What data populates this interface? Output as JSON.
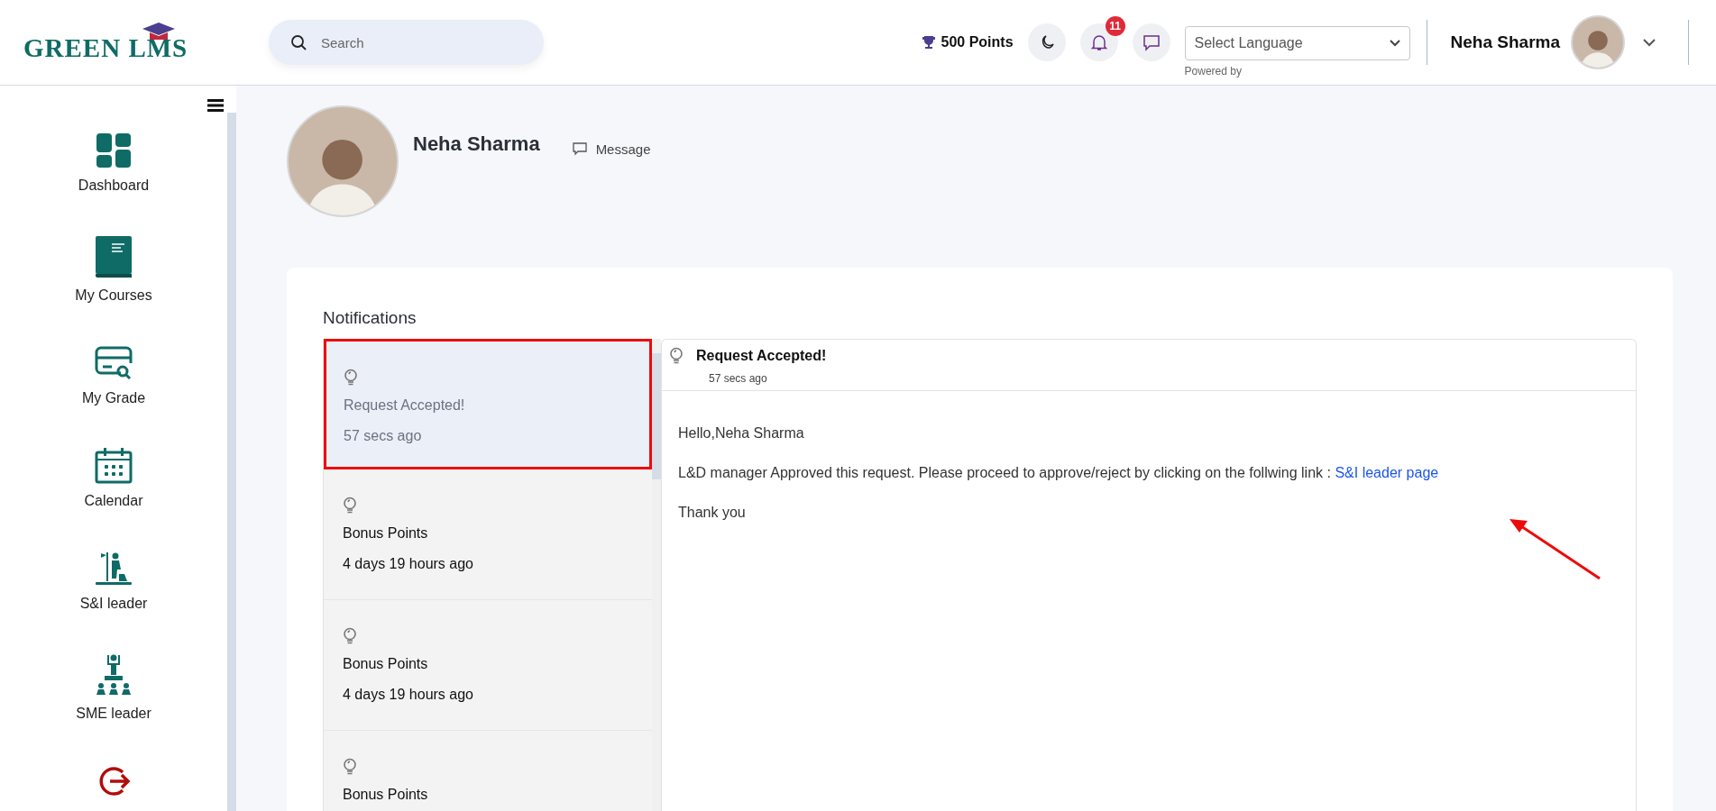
{
  "header": {
    "logo": "GREEN LMS",
    "search": {
      "placeholder": "Search"
    },
    "points": "500 Points",
    "notification_count": "11",
    "language_select": {
      "value": "Select Language",
      "note": "Powered by"
    },
    "user_name": "Neha Sharma"
  },
  "sidebar": {
    "items": [
      {
        "kind": "dashboard",
        "label": "Dashboard"
      },
      {
        "kind": "courses",
        "label": "My Courses"
      },
      {
        "kind": "grade",
        "label": "My Grade"
      },
      {
        "kind": "calendar",
        "label": "Calendar"
      },
      {
        "kind": "leader",
        "label": "S&I leader"
      },
      {
        "kind": "sme",
        "label": "SME leader"
      },
      {
        "kind": "logout"
      }
    ]
  },
  "profile": {
    "name": "Neha Sharma",
    "message_link": "Message"
  },
  "notifications": {
    "title": "Notifications",
    "items": [
      {
        "title": "Request Accepted!",
        "time": "57 secs ago",
        "selected": true
      },
      {
        "title": "Bonus Points",
        "time": "4 days 19 hours ago",
        "selected": false
      },
      {
        "title": "Bonus Points",
        "time": "4 days 19 hours ago",
        "selected": false
      },
      {
        "title": "Bonus Points",
        "selected": false
      }
    ],
    "detail": {
      "title": "Request Accepted!",
      "time": "57 secs ago",
      "greeting": "Hello,Neha Sharma",
      "body": "L&D manager Approved this request. Please proceed to approve/reject by clicking on the follwing link :",
      "link": "S&I leader page",
      "closing": "Thank you"
    }
  }
}
